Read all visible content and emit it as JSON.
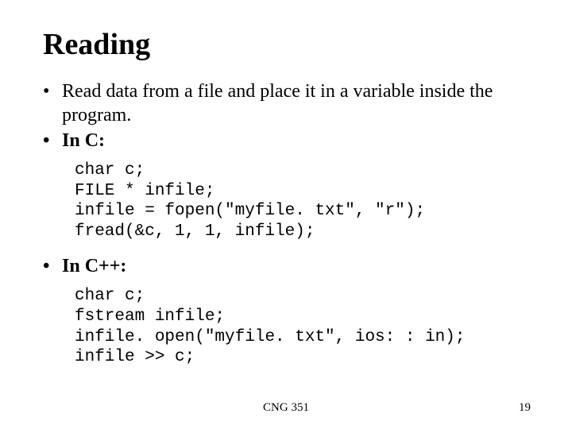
{
  "title": "Reading",
  "bullets": {
    "intro": "Read data from a file and place it in a variable inside the program.",
    "in_c_label": "In C:",
    "in_cpp_label": "In C++:"
  },
  "code": {
    "c": "char c;\nFILE * infile;\ninfile = fopen(\"myfile. txt\", \"r\");\nfread(&c, 1, 1, infile);",
    "cpp": "char c;\nfstream infile;\ninfile. open(\"myfile. txt\", ios: : in);\ninfile >> c;"
  },
  "footer": {
    "course": "CNG 351",
    "page": "19"
  }
}
